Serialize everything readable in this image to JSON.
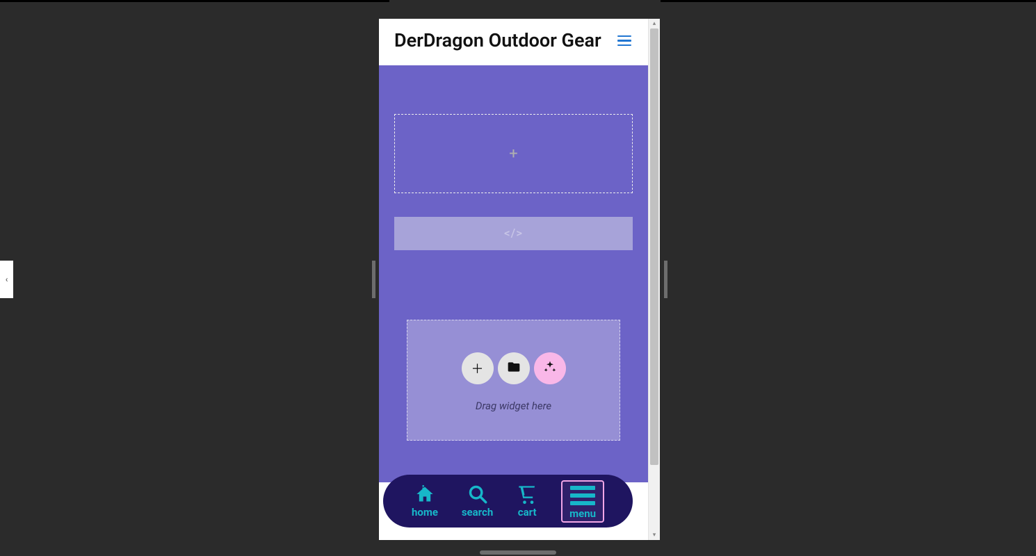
{
  "header": {
    "title": "DerDragon Outdoor Gear"
  },
  "hero": {
    "drop_label": "Drag widget here"
  },
  "bottom_nav": {
    "home": "home",
    "search": "search",
    "cart": "cart",
    "menu": "menu"
  },
  "icons": {
    "plus": "+",
    "code": "</>"
  }
}
